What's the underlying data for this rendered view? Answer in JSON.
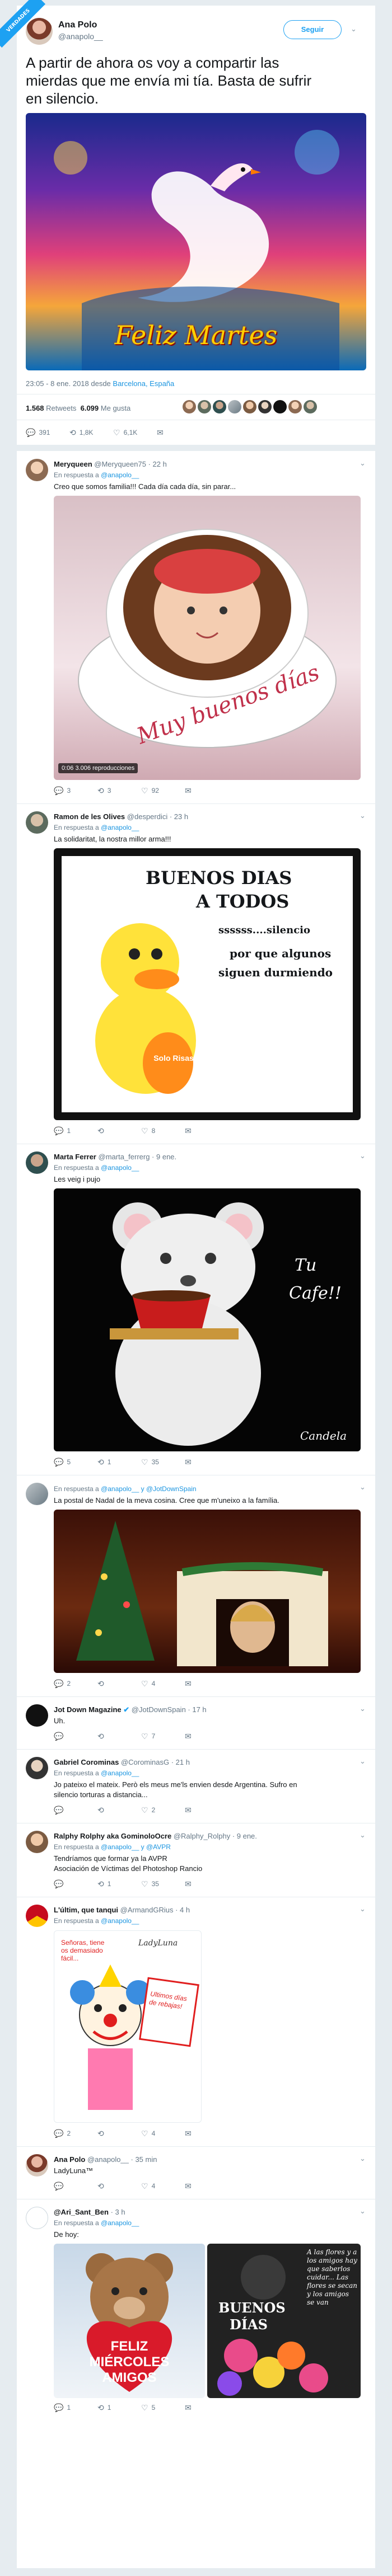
{
  "watermark": "VERDADES",
  "main": {
    "name": "Ana Polo",
    "handle": "@anapolo__",
    "follow": "Seguir",
    "text_lines": [
      "A partir de ahora os voy a compartir las",
      "mierdas que me envía mi tía. Basta de sufrir",
      "en silencio."
    ],
    "image_text": "Feliz Martes",
    "meta_time": "23:05 - 8 ene. 2018 desde ",
    "meta_place": "Barcelona, España",
    "retweets_count": "1.568",
    "retweets_label": "Retweets",
    "likes_count": "6.099",
    "likes_label": "Me gusta",
    "replies": "391",
    "retweets": "1,8K",
    "likes": "6,1K"
  },
  "replies": [
    {
      "name": "Meryqueen",
      "handle": "@Meryqueen75 · 22 h",
      "reply_to": "En respuesta a ",
      "reply_handle": "@anapolo__",
      "text": "Creo que somos familia!!! Cada día cada día, sin parar...",
      "video_time": "0:06",
      "video_views": "3.006 reproducciones",
      "image_text": "Muy buenos días",
      "r": "3",
      "rt": "3",
      "lk": "92"
    },
    {
      "name": "Ramon de les Olives",
      "handle": "@desperdici · 23 h",
      "reply_to": "En respuesta a ",
      "reply_handle": "@anapolo__",
      "text": "La solidaritat, la nostra millor arma!!!",
      "image_line1": "BUENOS DIAS",
      "image_line2": "A TODOS",
      "image_line3": "ssssss....silencio",
      "image_line4": "por que algunos",
      "image_line5": "siguen durmiendo",
      "image_badge": "Solo Risas",
      "r": "1",
      "rt": "",
      "lk": "8"
    },
    {
      "name": "Marta Ferrer",
      "handle": "@marta_ferrerg · 9 ene.",
      "reply_to": "En respuesta a ",
      "reply_handle": "@anapolo__",
      "text": "Les veig i pujo",
      "image_text1": "Tu",
      "image_text2": "Cafe!!",
      "image_text3": "Candela",
      "r": "5",
      "rt": "1",
      "lk": "35"
    },
    {
      "name": "",
      "handle": "",
      "reply_to": "En respuesta a ",
      "reply_handle": "@anapolo__ y @JotDownSpain",
      "text": "La postal de Nadal de la meva cosina. Cree que m'uneixo a la família.",
      "r": "2",
      "rt": "",
      "lk": "4"
    },
    {
      "name": "Jot Down Magazine",
      "handle": "@JotDownSpain · 17 h",
      "reply_to": "",
      "reply_handle": "",
      "text": "Uh.",
      "r": "",
      "rt": "",
      "lk": "7"
    },
    {
      "name": "Gabriel Corominas",
      "handle": "@CorominasG · 21 h",
      "reply_to": "En respuesta a ",
      "reply_handle": "@anapolo__",
      "text": "Jo pateixo el mateix. Però els meus me'ls envien desde Argentina. Sufro en",
      "text2": "silencio torturas a distancia...",
      "r": "",
      "rt": "",
      "lk": "2"
    },
    {
      "name": "Ralphy Rolphy aka GominoloOcre",
      "handle": "@Ralphy_Rolphy · 9 ene.",
      "reply_to": "En respuesta a ",
      "reply_handle": "@anapolo__ y @AVPR",
      "text": "Tendríamos que formar ya la AVPR",
      "text2": "Asociación de Víctimas del Photoshop Rancio",
      "r": "",
      "rt": "1",
      "lk": "35"
    },
    {
      "name": "L'últim, que tanqui",
      "handle": "@ArmandGRius · 4 h",
      "reply_to": "En respuesta a ",
      "reply_handle": "@anapolo__",
      "text": "",
      "image_text1": "Señoras, tiene os demasiado fácil...",
      "image_text2": "LadyLuna",
      "image_text3": "Ultimos días de rebajas!",
      "r": "2",
      "rt": "",
      "lk": "4"
    },
    {
      "name": "Ana Polo",
      "handle": "@anapolo__ · 35 min",
      "reply_to": "",
      "reply_handle": "",
      "text": "LadyLuna™",
      "r": "",
      "rt": "",
      "lk": "4"
    },
    {
      "name": "@Ari_Sant_Ben",
      "handle": "· 3 h",
      "reply_to": "En respuesta a ",
      "reply_handle": "@anapolo__",
      "text": "De hoy:",
      "image_left": "FELIZ MIÉRCOLES AMIGOS",
      "image_right1": "BUENOS",
      "image_right2": "DÍAS",
      "image_side": "A las flores y a los amigos hay que saberlos cuidar... Las flores se secan y los amigos se van",
      "r": "1",
      "rt": "1",
      "lk": "5"
    }
  ],
  "colors": {
    "accent": "#1da1f2",
    "bg": "#e6ecf0",
    "text": "#14171a",
    "muted": "#657786"
  }
}
